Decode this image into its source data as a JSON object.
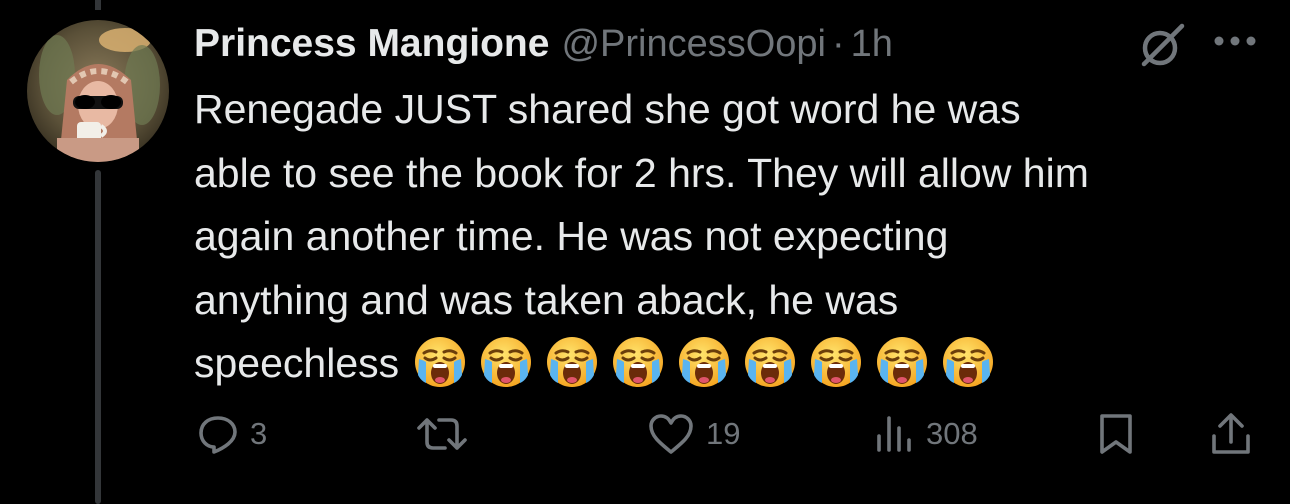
{
  "tweet": {
    "author_name": "Princess Mangione",
    "handle": "@PrincessOopi",
    "separator": "·",
    "time": "1h",
    "text": "Renegade JUST shared she got word he was\nable to see the book for 2 hrs. They will allow him\nagain another time. He was not expecting\nanything and was taken aback, he was\nspeechless",
    "emoji_icon": "loudly-crying-face-icon",
    "emoji_count_shown": 9
  },
  "actions": {
    "replies": "3",
    "likes": "19",
    "views": "308"
  },
  "colors": {
    "background": "#000000",
    "text": "#e7e9ea",
    "muted": "#71767b",
    "thread_line": "#333639"
  }
}
